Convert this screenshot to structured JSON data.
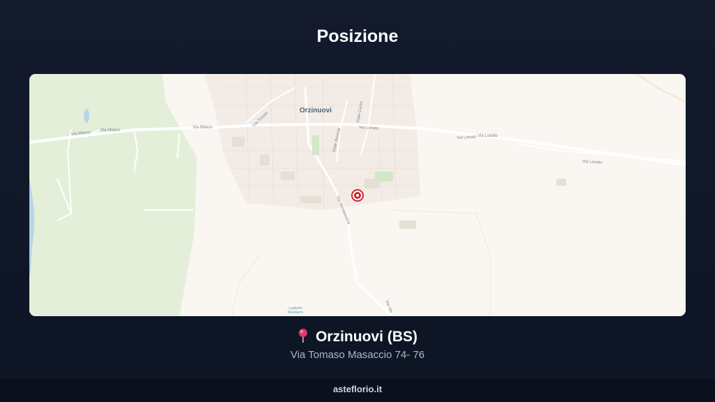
{
  "header": {
    "title": "Posizione"
  },
  "map": {
    "town_label": "Orzinuovi",
    "streets": {
      "milano": "Via Milano",
      "lonato": "Via Lonato",
      "trieste": "Via Trieste",
      "carso": "Viale Carso",
      "brescia": "Viale Brescia",
      "verolanuova": "Via Verolanuova",
      "ver": "Via Ver"
    },
    "poi_label": [
      "Laghetto",
      "Mandarini"
    ],
    "colors": {
      "park": "#e4efd9",
      "land": "#faf6f2",
      "road": "#ffffff",
      "marker": "#c62a2f"
    }
  },
  "location": {
    "city": "Orzinuovi (BS)",
    "address": "Via Tomaso Masaccio 74- 76"
  },
  "footer": {
    "site": "asteflorio.it"
  }
}
